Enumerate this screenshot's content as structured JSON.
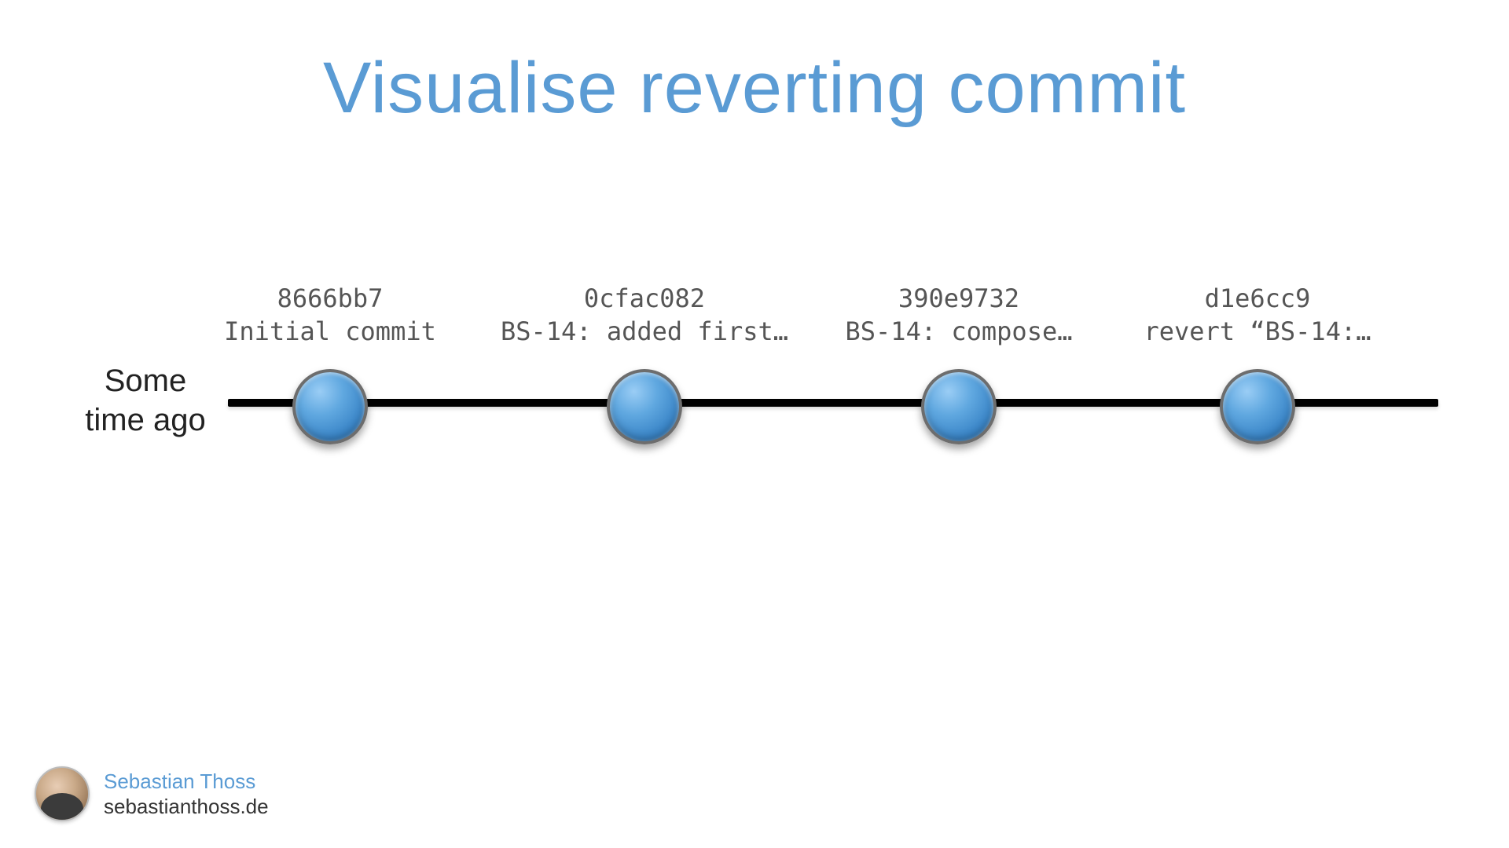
{
  "title": "Visualise reverting commit",
  "timeline": {
    "start_label": "Some\ntime ago",
    "commits": [
      {
        "hash": "8666bb7",
        "message": "Initial commit"
      },
      {
        "hash": "0cfac082",
        "message": "BS-14: added first…"
      },
      {
        "hash": "390e9732",
        "message": "BS-14: compose…"
      },
      {
        "hash": "d1e6cc9",
        "message": "revert “BS-14:…"
      }
    ]
  },
  "author": {
    "name": "Sebastian Thoss",
    "site": "sebastianthoss.de"
  },
  "colors": {
    "title": "#5a9bd4",
    "commit_node": "#3b86c8"
  }
}
